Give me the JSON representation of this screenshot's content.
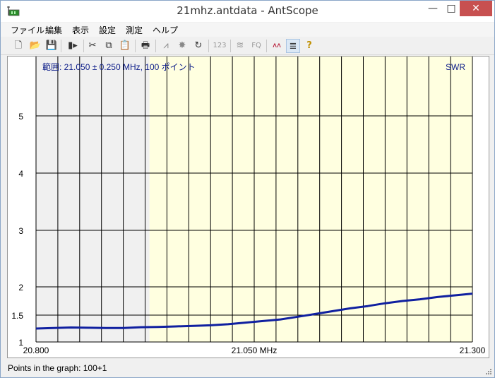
{
  "window": {
    "title": "21mhz.antdata - AntScope",
    "minimize": "—",
    "maximize": "□",
    "close": "✕"
  },
  "menu": [
    "ファイル",
    "編集",
    "表示",
    "設定",
    "測定",
    "ヘルプ"
  ],
  "toolbar": [
    {
      "icon": "new-file-icon",
      "glyph": "🗋"
    },
    {
      "icon": "open-folder-icon",
      "glyph": "📂"
    },
    {
      "icon": "save-icon",
      "glyph": "💾"
    },
    {
      "icon": "import-icon",
      "glyph": "▮▸"
    },
    {
      "icon": "cut-icon",
      "glyph": "✂"
    },
    {
      "icon": "copy-icon",
      "glyph": "⧉"
    },
    {
      "icon": "paste-icon",
      "glyph": "📋"
    },
    {
      "icon": "print-icon",
      "glyph": "🖶"
    },
    {
      "icon": "sweep-icon",
      "glyph": "⩘"
    },
    {
      "icon": "stop-icon",
      "glyph": "✸"
    },
    {
      "icon": "refresh-icon",
      "glyph": "↻"
    },
    {
      "icon": "numeric-icon",
      "glyph": "123"
    },
    {
      "icon": "wifi-icon",
      "glyph": "≋"
    },
    {
      "icon": "frequency-icon",
      "glyph": "FQ"
    },
    {
      "icon": "curves-icon",
      "glyph": "ʌʌ"
    },
    {
      "icon": "notes-icon",
      "glyph": "≣"
    },
    {
      "icon": "help-icon",
      "glyph": "?"
    }
  ],
  "chart_data": {
    "type": "line",
    "range_label": "範囲: 21.050 ± 0.250 MHz, 100 ポイント",
    "series_label": "SWR",
    "xlim": [
      20.8,
      21.3
    ],
    "ylim": [
      1,
      6
    ],
    "y_scale": "swr",
    "x_ticks": [
      "20.800",
      "21.050 MHz",
      "21.300"
    ],
    "y_ticks": [
      1,
      1.5,
      2,
      3,
      4,
      5
    ],
    "band_range": [
      20.93,
      21.28
    ],
    "grid": true,
    "colors": {
      "out_of_band": "#f0f0f0",
      "in_band": "#ffffe0",
      "trace": "#1020a0",
      "grid": "#000000"
    },
    "points": [
      [
        20.8,
        1.25
      ],
      [
        20.82,
        1.26
      ],
      [
        20.84,
        1.27
      ],
      [
        20.86,
        1.265
      ],
      [
        20.88,
        1.26
      ],
      [
        20.9,
        1.26
      ],
      [
        20.92,
        1.275
      ],
      [
        20.94,
        1.28
      ],
      [
        20.96,
        1.29
      ],
      [
        20.98,
        1.3
      ],
      [
        21.0,
        1.31
      ],
      [
        21.02,
        1.33
      ],
      [
        21.04,
        1.36
      ],
      [
        21.06,
        1.39
      ],
      [
        21.08,
        1.42
      ],
      [
        21.1,
        1.47
      ],
      [
        21.12,
        1.52
      ],
      [
        21.14,
        1.57
      ],
      [
        21.16,
        1.62
      ],
      [
        21.18,
        1.66
      ],
      [
        21.2,
        1.71
      ],
      [
        21.22,
        1.75
      ],
      [
        21.24,
        1.78
      ],
      [
        21.26,
        1.82
      ],
      [
        21.28,
        1.85
      ],
      [
        21.3,
        1.88
      ]
    ]
  },
  "status": {
    "text": "Points in the graph: 100+1"
  }
}
